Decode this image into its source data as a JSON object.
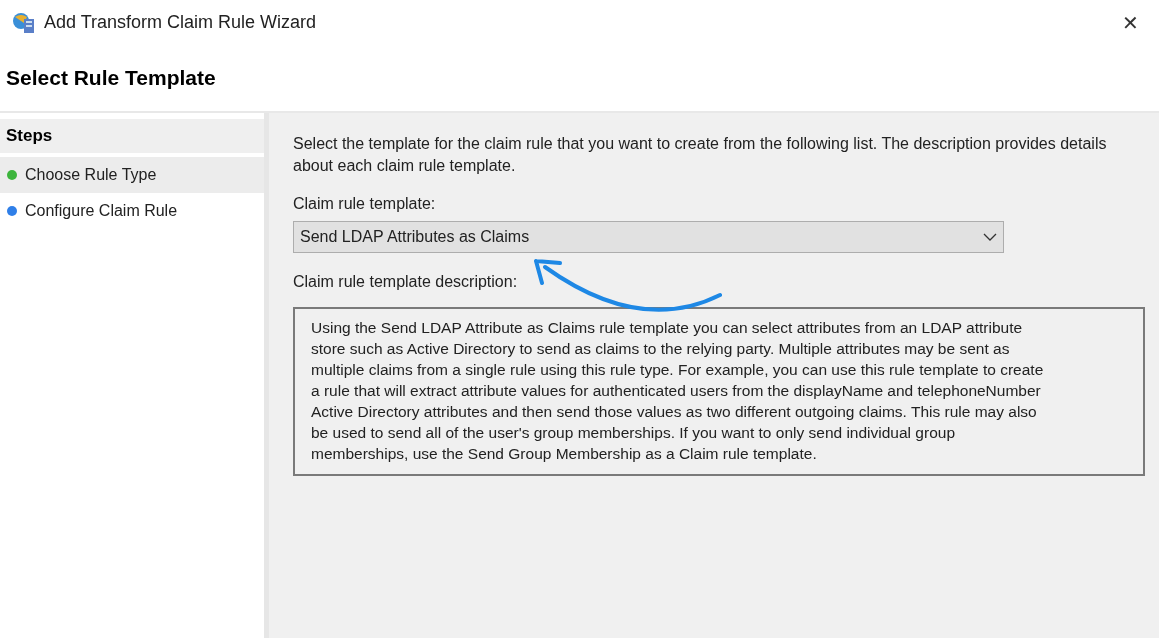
{
  "window": {
    "title": "Add Transform Claim Rule Wizard",
    "close": "✕"
  },
  "page_title": "Select Rule Template",
  "steps": {
    "title": "Steps",
    "items": [
      {
        "label": "Choose Rule Type",
        "selected": true,
        "color": "#3cb43c"
      },
      {
        "label": "Configure Claim Rule",
        "selected": false,
        "color": "#2f7fe8"
      }
    ]
  },
  "intro": "Select the template for the claim rule that you want to create from the following list. The description provides details about each claim rule template.",
  "template": {
    "label": "Claim rule template:",
    "value": "Send LDAP Attributes as Claims"
  },
  "description": {
    "label": "Claim rule template description:",
    "lines": [
      "Using the Send LDAP Attribute as Claims rule template you can select attributes from an LDAP attribute",
      "store such as Active Directory to send as claims to the relying party. Multiple attributes may be sent as",
      "multiple claims from a single rule using this rule type. For example, you can use this rule template to create",
      "a rule that will extract attribute values for authenticated users from the displayName and telephoneNumber",
      "Active Directory attributes and then send those values as two different outgoing claims. This rule may also",
      "be used to send all of the user's group memberships. If you want to only send individual group",
      "memberships, use the Send Group Membership as a Claim rule template."
    ]
  }
}
